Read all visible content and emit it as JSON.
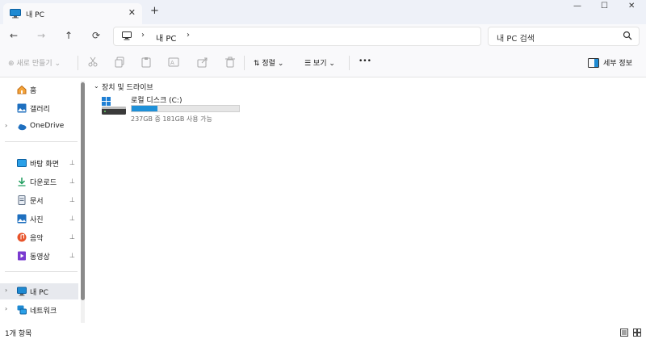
{
  "window": {
    "tab_label": "내 PC",
    "tab_close": "✕",
    "new_tab": "+",
    "minimize": "—",
    "maximize": "☐",
    "close": "✕"
  },
  "nav": {
    "back": "←",
    "forward": "→",
    "up": "↑",
    "refresh": "⟳",
    "breadcrumb_sep": "›",
    "location": "내 PC",
    "search_placeholder": "내 PC 검색"
  },
  "toolbar": {
    "new": "⊕ 새로 만들기 ⌄",
    "sort": "⇅ 정렬 ⌄",
    "view": "☰ 보기 ⌄",
    "more": "•••",
    "details": "세부 정보"
  },
  "sidebar": {
    "items": [
      {
        "label": "홈",
        "icon": "home-icon"
      },
      {
        "label": "갤러리",
        "icon": "gallery-icon"
      },
      {
        "label": "OneDrive",
        "icon": "cloud-icon",
        "expand": "›"
      },
      {
        "label": "바탕 화면",
        "icon": "desktop-icon"
      },
      {
        "label": "다운로드",
        "icon": "download-icon"
      },
      {
        "label": "문서",
        "icon": "document-icon"
      },
      {
        "label": "사진",
        "icon": "picture-icon"
      },
      {
        "label": "음악",
        "icon": "music-icon"
      },
      {
        "label": "동영상",
        "icon": "video-icon"
      },
      {
        "label": "내 PC",
        "icon": "pc-icon",
        "expand": "›"
      },
      {
        "label": "네트워크",
        "icon": "network-icon",
        "expand": "›"
      }
    ],
    "pin_glyph": "📌"
  },
  "content": {
    "group_chevron": "⌄",
    "group_label": "장치 및 드라이브",
    "drive": {
      "name": "로컬 디스크 (C:)",
      "space": "237GB 중 181GB 사용 가능",
      "used_fraction": 0.24
    }
  },
  "status": {
    "count": "1개 항목"
  },
  "colors": {
    "accent": "#1e90d8",
    "titlebar": "#eef1f8",
    "selected": "#e7e9ee"
  }
}
